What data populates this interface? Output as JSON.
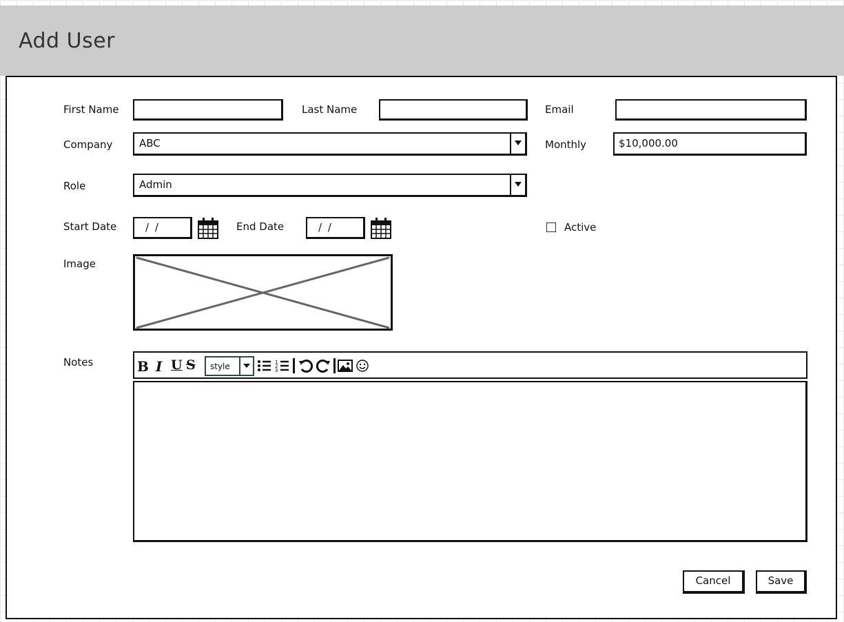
{
  "header": {
    "title": "Add User"
  },
  "form": {
    "first_name": {
      "label": "First Name",
      "value": ""
    },
    "last_name": {
      "label": "Last Name",
      "value": ""
    },
    "email": {
      "label": "Email",
      "value": ""
    },
    "company": {
      "label": "Company",
      "value": "ABC"
    },
    "monthly": {
      "label": "Monthly",
      "value": "$10,000.00"
    },
    "role": {
      "label": "Role",
      "value": "Admin"
    },
    "start_date": {
      "label": "Start Date",
      "value": "/ /"
    },
    "end_date": {
      "label": "End Date",
      "value": "/ /"
    },
    "active": {
      "label": "Active",
      "checked": false
    },
    "image": {
      "label": "Image"
    },
    "notes": {
      "label": "Notes",
      "toolbar": {
        "bold": "B",
        "italic": "I",
        "underline": "U",
        "strike": "S",
        "style_select": "style",
        "icons": [
          "bullet-list-icon",
          "numbered-list-icon",
          "undo-icon",
          "redo-icon",
          "image-icon",
          "emoji-icon"
        ]
      },
      "value": ""
    }
  },
  "actions": {
    "cancel": "Cancel",
    "save": "Save"
  }
}
